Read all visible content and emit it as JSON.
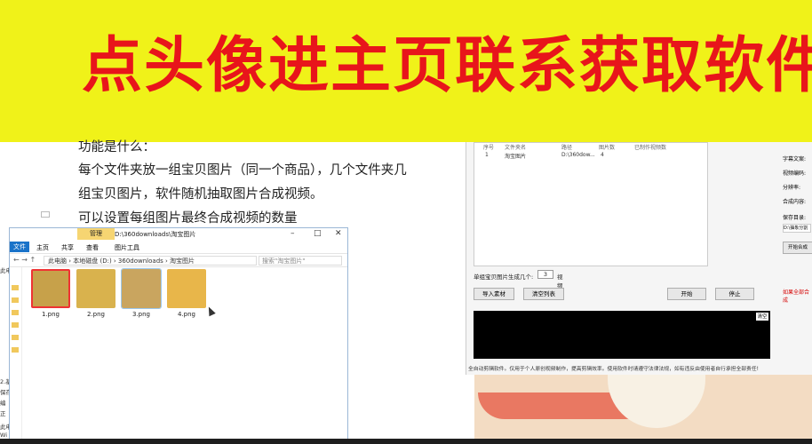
{
  "banner": {
    "title": "点头像进主页联系获取软件"
  },
  "document": {
    "lines": [
      "功能是什么：",
      "每个文件夹放一组宝贝图片（同一个商品），几个文件夹几",
      "组宝贝图片，软件随机抽取图片合成视频。",
      "可以设置每组图片最终合成视频的数量"
    ]
  },
  "explorer": {
    "manage_tab": "管理",
    "title": "D:\\360downloads\\淘宝图片",
    "ribbon_tabs": [
      "文件",
      "主页",
      "共享",
      "查看",
      "图片工具"
    ],
    "breadcrumb": "此电脑 › 本地磁盘 (D:) › 360downloads › 淘宝图片",
    "search_placeholder": "搜索\"淘宝图片\"",
    "files": [
      {
        "name": "1.png",
        "color": "#c7a14a"
      },
      {
        "name": "2.png",
        "color": "#d9b24d"
      },
      {
        "name": "3.png",
        "color": "#c9a55f"
      },
      {
        "name": "4.png",
        "color": "#e8b64a"
      }
    ]
  },
  "gutter_labels": [
    "此电脑",
    "2.基",
    "保存",
    "编",
    "正",
    "此电",
    "Wi"
  ],
  "tool": {
    "table_headers": [
      "序号",
      "文件夹名",
      "路径",
      "图片数",
      "已制作视频数"
    ],
    "table_row": [
      "1",
      "淘宝图片",
      "D:\\360dow...",
      "4",
      ""
    ],
    "right_labels": [
      "字幕文案:",
      "视频编码:",
      "分辨率:",
      "合成内容:",
      "保存目录:"
    ],
    "save_dir": "D:\\抽象分割",
    "start_compose": "开始合成",
    "gen_label": "单组宝贝图片生成几个:",
    "gen_value": "3",
    "gen_unit": "视频",
    "buttons": [
      "导入素材",
      "清空列表",
      "开始",
      "停止"
    ],
    "log_clear": "清空",
    "warning": "如果全部合成",
    "disclaimer": "全自动剪辑软件。仅用于个人原创视频制作，提高剪辑效率。使用软件时请遵守法律法规，如有违反由使用者自行承担全部责任!"
  }
}
